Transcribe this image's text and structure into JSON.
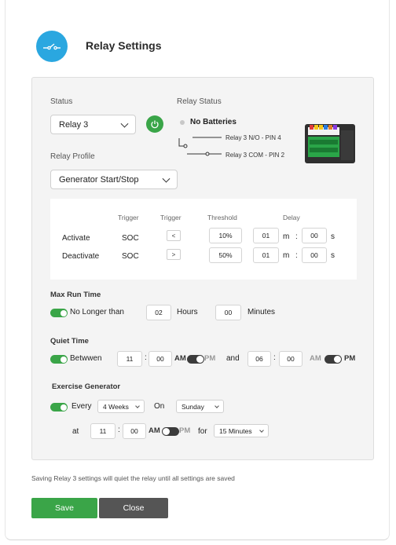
{
  "header": {
    "title": "Relay Settings",
    "icon": "relay-switch-icon",
    "icon_color": "#2aa7e0"
  },
  "status": {
    "label": "Status",
    "selected": "Relay 3",
    "relay_status_label": "Relay Status",
    "relay_state": "No Batteries",
    "pin_no": "Relay 3 N/O - PIN 4",
    "pin_com": "Relay 3 COM  - PIN 2"
  },
  "profile": {
    "label": "Relay Profile",
    "selected": "Generator Start/Stop"
  },
  "triggers": {
    "headers": {
      "trigger1": "Trigger",
      "trigger2": "Trigger",
      "threshold": "Threshold",
      "delay": "Delay"
    },
    "rows": [
      {
        "name": "Activate",
        "trigger": "SOC",
        "op": "<",
        "threshold": "10%",
        "min": "01",
        "m": "m",
        "colon": ":",
        "sec": "00",
        "s": "s"
      },
      {
        "name": "Deactivate",
        "trigger": "SOC",
        "op": ">",
        "threshold": "50%",
        "min": "01",
        "m": "m",
        "colon": ":",
        "sec": "00",
        "s": "s"
      }
    ]
  },
  "max_run": {
    "title": "Max Run Time",
    "label": "No Longer than",
    "hours": "02",
    "hours_label": "Hours",
    "minutes": "00",
    "minutes_label": "Minutes"
  },
  "quiet": {
    "title": "Quiet Time",
    "label": "Betwwen",
    "start_h": "11",
    "start_m": "00",
    "am": "AM",
    "pm": "PM",
    "and": "and",
    "end_h": "06",
    "end_m": "00",
    "colon": ":"
  },
  "exercise": {
    "title": "Exercise Generator",
    "every": "Every",
    "period": "4 Weeks",
    "on": "On",
    "day": "Sunday",
    "at": "at",
    "hour": "11",
    "min": "00",
    "am": "AM",
    "pm": "PM",
    "for": "for",
    "duration": "15 Minutes",
    "colon": ":"
  },
  "footer": {
    "note": "Saving Relay 3 settings will quiet the relay until all settings are saved",
    "save": "Save",
    "close": "Close"
  },
  "colors": {
    "accent": "#3aa548",
    "dark_button": "#555555",
    "brand_blue": "#2aa7e0"
  }
}
